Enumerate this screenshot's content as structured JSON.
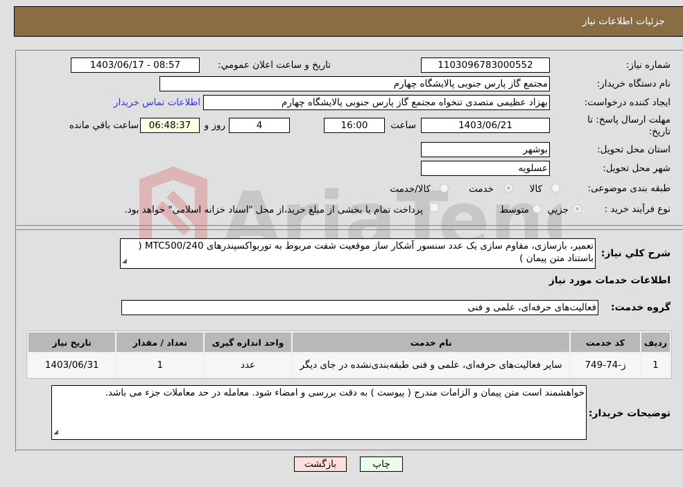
{
  "header": {
    "title": "جزئیات اطلاعات نیاز"
  },
  "fields": {
    "need_number": {
      "label": "شماره نیاز:",
      "value": "1103096783000552"
    },
    "announce_datetime": {
      "label": "تاریخ و ساعت اعلان عمومي:",
      "value": "1403/06/17 - 08:57"
    },
    "buyer_org": {
      "label": "نام دستگاه خریدار:",
      "value": "مجتمع گاز پارس جنوبی  پالایشگاه چهارم"
    },
    "creator": {
      "label": "ایجاد کننده درخواست:",
      "value": "بهزاد عظیمی متصدی تنخواه مجتمع گاز پارس جنوبی  پالایشگاه چهارم"
    },
    "contact_link": "اطلاعات تماس خریدار",
    "deadline": {
      "label": "مهلت ارسال پاسخ: تا تاریخ:",
      "date": "1403/06/21",
      "time_label": "ساعت",
      "time": "16:00",
      "days": "4",
      "days_label": "روز و",
      "remaining": "06:48:37",
      "remaining_label": "ساعت باقي مانده"
    },
    "province": {
      "label": "استان محل تحویل:",
      "value": "بوشهر"
    },
    "city": {
      "label": "شهر محل تحویل:",
      "value": "عسلویه"
    },
    "category": {
      "label": "طبقه بندی موضوعی:",
      "options": [
        "کالا",
        "خدمت",
        "کالا/خدمت"
      ],
      "selected": "خدمت"
    },
    "purchase_type": {
      "label": "نوع فرآیند خرید :",
      "options": [
        "جزيي",
        "متوسط"
      ],
      "selected": "جزيي",
      "treasury_note": "پرداخت تمام یا بخشی از مبلغ خرید،از محل \"اسناد خزانه اسلامی\" خواهد بود."
    }
  },
  "description": {
    "label": "شرح کلي نیاز:",
    "value": "تعمیر، بازسازی، مقاوم سازی یک عدد سنسور آشکار ساز موقعیت شفت مربوط به توربواکسپندرهای MTC500/240 ( باستناد متن پیمان )"
  },
  "services": {
    "section_title": "اطلاعات خدمات مورد نیاز",
    "group_label": "گروه خدمت:",
    "group_value": "فعالیت‌های حرفه‌ای، علمی و فنی",
    "columns": [
      "ردیف",
      "کد خدمت",
      "نام خدمت",
      "واحد اندازه گیری",
      "تعداد / مقدار",
      "تاریخ نیاز"
    ],
    "rows": [
      [
        "1",
        "ز-74-749",
        "سایر فعالیت‌های حرفه‌ای، علمی و فنی طبقه‌بندی‌نشده در جای دیگر",
        "عدد",
        "1",
        "1403/06/31"
      ]
    ]
  },
  "buyer_notes": {
    "label": "توضیحات خریدار:",
    "value": "خواهشمند است متن پیمان و الزامات مندرج ( پیوست ) به دقت بررسی و امضاء شود. معامله در حد معاملات جزء می باشد."
  },
  "buttons": {
    "print": "چاپ",
    "back": "بازگشت"
  },
  "colors": {
    "header_bg": "#8b6d43",
    "print_bg": "#eaffea",
    "back_bg": "#ffdede",
    "link": "#3030ff"
  }
}
